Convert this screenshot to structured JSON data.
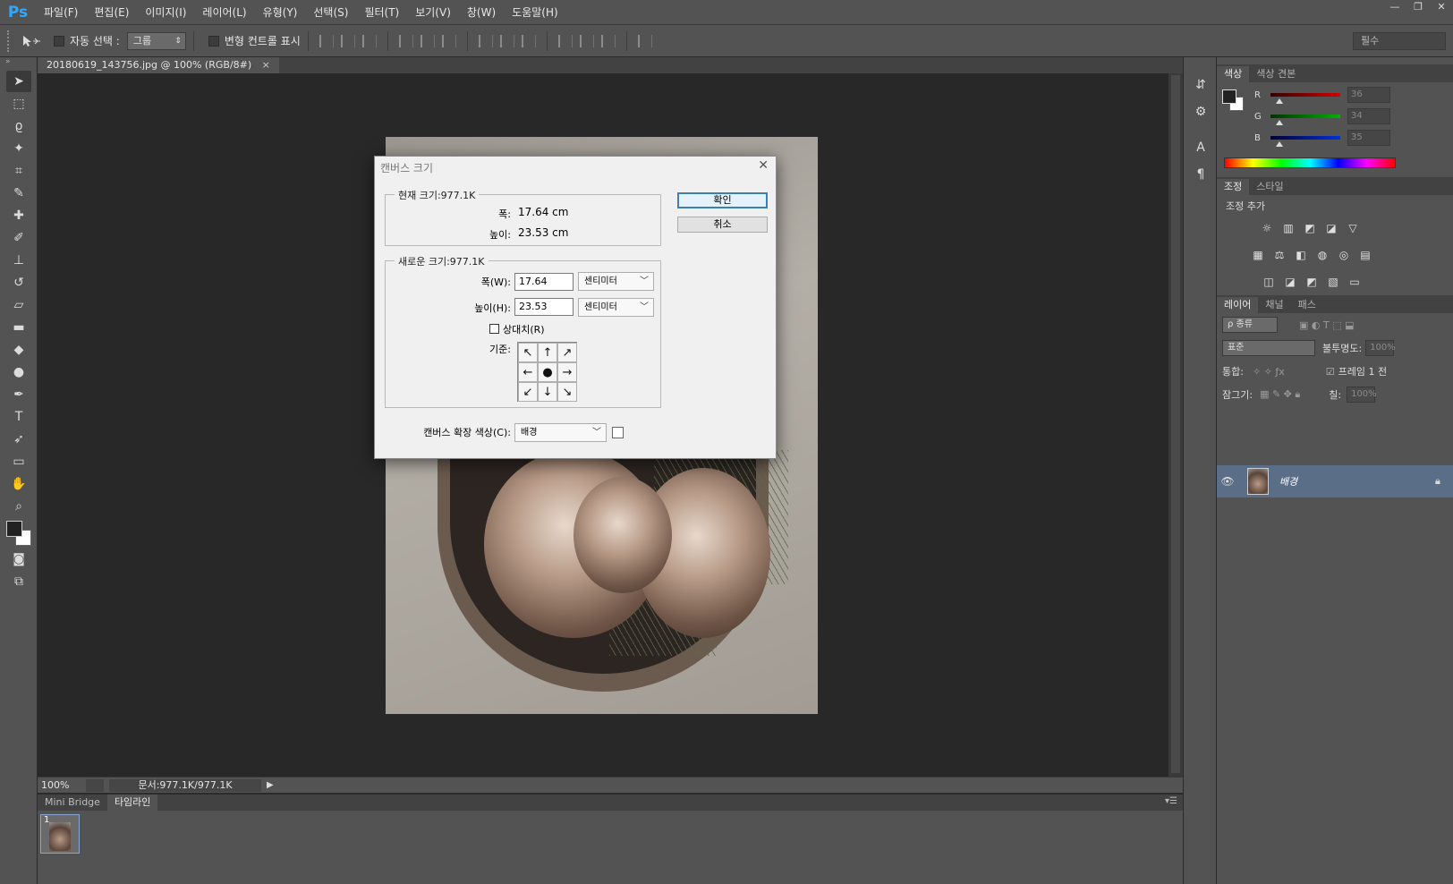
{
  "app": {
    "logo": "Ps",
    "menu": [
      "파일(F)",
      "편집(E)",
      "이미지(I)",
      "레이어(L)",
      "유형(Y)",
      "선택(S)",
      "필터(T)",
      "보기(V)",
      "창(W)",
      "도움말(H)"
    ],
    "window_controls": [
      "—",
      "❐",
      "✕"
    ]
  },
  "options_bar": {
    "auto_select_label": "자동 선택 :",
    "auto_select_value": "그룹",
    "show_transform_label": "변형 컨트롤 표시",
    "workspace": "필수"
  },
  "document": {
    "tab_title": "20180619_143756.jpg @ 100% (RGB/8#)",
    "tab_close": "×"
  },
  "status_bar": {
    "zoom": "100%",
    "doc_size": "문서:977.1K/977.1K",
    "arrow": "▶"
  },
  "bottom_panel": {
    "tabs": [
      "Mini Bridge",
      "타임라인"
    ],
    "frame_number": "1",
    "menu_glyph": "▾☰"
  },
  "color_panel": {
    "tabs": [
      "색상",
      "색상 견본"
    ],
    "channels": [
      {
        "label": "R",
        "value": "36",
        "gradient": "#d40000"
      },
      {
        "label": "G",
        "value": "34",
        "gradient": "#00b400"
      },
      {
        "label": "B",
        "value": "35",
        "gradient": "#0030e0"
      }
    ]
  },
  "adjustments_panel": {
    "tabs": [
      "조정",
      "스타일"
    ],
    "title": "조정 추가",
    "row1": [
      "☼",
      "▥",
      "◩",
      "◪",
      "▽"
    ],
    "row2": [
      "▦",
      "⚖",
      "◧",
      "◍",
      "◎",
      "▤"
    ],
    "row3": [
      "◫",
      "◪",
      "◩",
      "▧",
      "▭"
    ]
  },
  "layers_panel": {
    "tabs": [
      "레이어",
      "채널",
      "패스"
    ],
    "filter_kind": "ρ 종류",
    "blend_mode": "표준",
    "opacity_label": "불투명도:",
    "opacity_value": "100%",
    "unify_label": "통합:",
    "frame_label": "프레임 1 전",
    "lock_label": "잠그기:",
    "fill_label": "칠:",
    "fill_value": "100%",
    "layer_name": "배경"
  },
  "dialog": {
    "title": "캔버스 크기",
    "close": "✕",
    "current_size_legend": "현재 크기:977.1K",
    "current_width_label": "폭:",
    "current_width_value": "17.64 cm",
    "current_height_label": "높이:",
    "current_height_value": "23.53 cm",
    "new_size_legend": "새로운 크기:977.1K",
    "width_label": "폭(W):",
    "width_value": "17.64",
    "width_unit": "센티미터",
    "height_label": "높이(H):",
    "height_value": "23.53",
    "height_unit": "센티미터",
    "relative_label": "상대치(R)",
    "anchor_label": "기준:",
    "anchor_arrows": [
      "↖",
      "↑",
      "↗",
      "←",
      "●",
      "→",
      "↙",
      "↓",
      "↘"
    ],
    "ext_color_label": "캔버스 확장 색상(C):",
    "ext_color_value": "배경",
    "ok_label": "확인",
    "cancel_label": "취소"
  }
}
